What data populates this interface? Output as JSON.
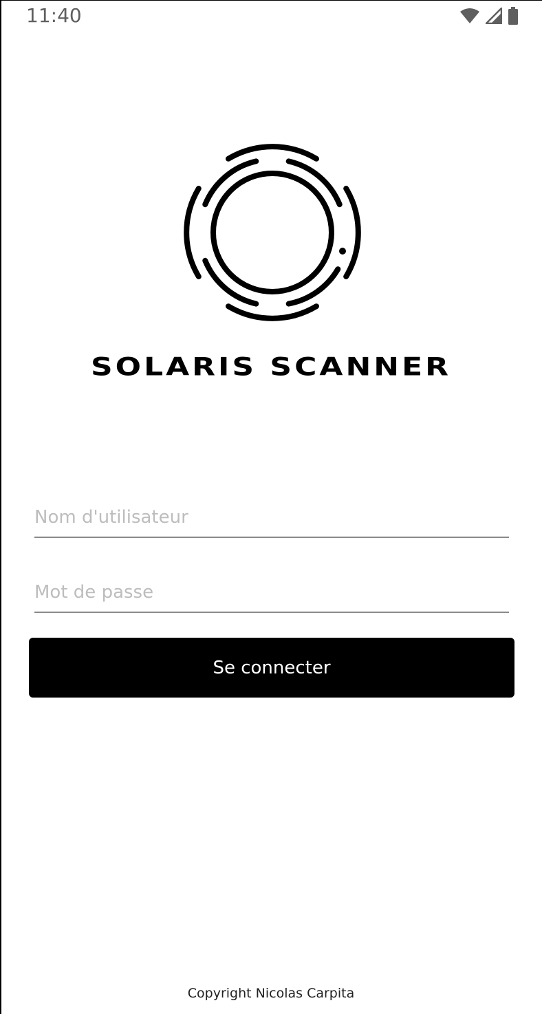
{
  "status_bar": {
    "time": "11:40",
    "icons": [
      "wifi-icon",
      "cellular-signal-icon",
      "battery-icon"
    ]
  },
  "logo": {
    "icon": "solaris-ring-logo",
    "title": "SOLARIS SCANNER"
  },
  "login_form": {
    "username_placeholder": "Nom d'utilisateur",
    "username_value": "",
    "password_placeholder": "Mot de passe",
    "password_value": "",
    "submit_label": "Se connecter"
  },
  "footer": {
    "copyright": "Copyright Nicolas Carpita"
  },
  "colors": {
    "primary": "#000000",
    "background": "#ffffff",
    "placeholder": "#bdbdbd",
    "underline": "#8a8a8a"
  }
}
